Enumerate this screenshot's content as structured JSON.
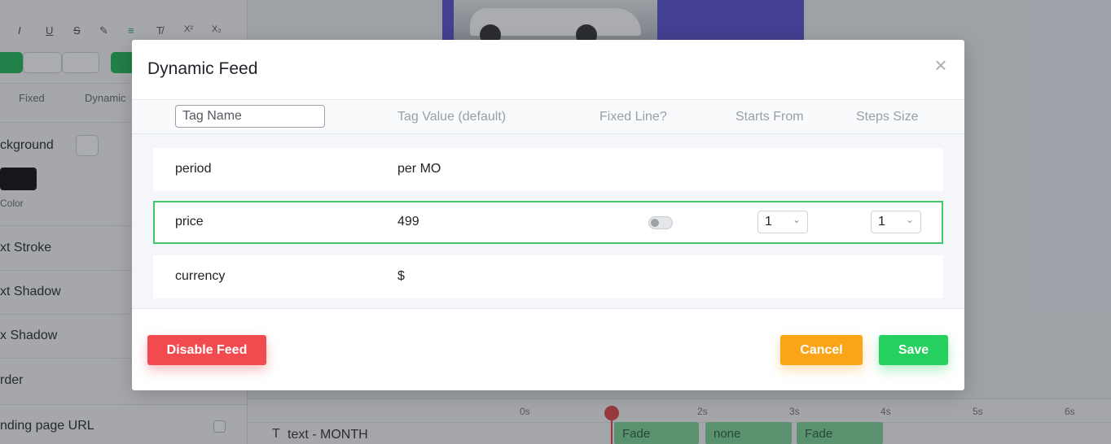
{
  "editor": {
    "format_buttons": [
      "I",
      "U",
      "S",
      "✎",
      "≡",
      "T̸",
      "X²",
      "X₂"
    ],
    "tabs": [
      "Fixed",
      "Dynamic"
    ],
    "sections": {
      "background": "ckground",
      "color": "Color",
      "text_stroke": "xt Stroke",
      "text_shadow": "xt Shadow",
      "box_shadow": "x Shadow",
      "border": "rder",
      "landing": "nding page URL"
    }
  },
  "timeline": {
    "ticks": [
      "0s",
      "2s",
      "3s",
      "4s",
      "5s",
      "6s"
    ],
    "layer_name": "text - MONTH",
    "clips": [
      "Fade",
      "none",
      "Fade"
    ]
  },
  "modal": {
    "title": "Dynamic Feed",
    "close_icon": "×",
    "headers": {
      "tag_name_placeholder": "Tag Name",
      "tag_value": "Tag Value (default)",
      "fixed_line": "Fixed Line?",
      "starts_from": "Starts From",
      "steps_size": "Steps Size"
    },
    "rows": [
      {
        "name": "period",
        "value": "per MO"
      },
      {
        "name": "price",
        "value": "499",
        "fixed_line": false,
        "starts_from": "1",
        "steps_size": "1"
      },
      {
        "name": "currency",
        "value": "$"
      }
    ],
    "buttons": {
      "disable": "Disable Feed",
      "cancel": "Cancel",
      "save": "Save"
    },
    "colors": {
      "disable": "#f24b4f",
      "cancel": "#fba418",
      "save": "#25d05e",
      "active_row_border": "#43c56b"
    }
  }
}
